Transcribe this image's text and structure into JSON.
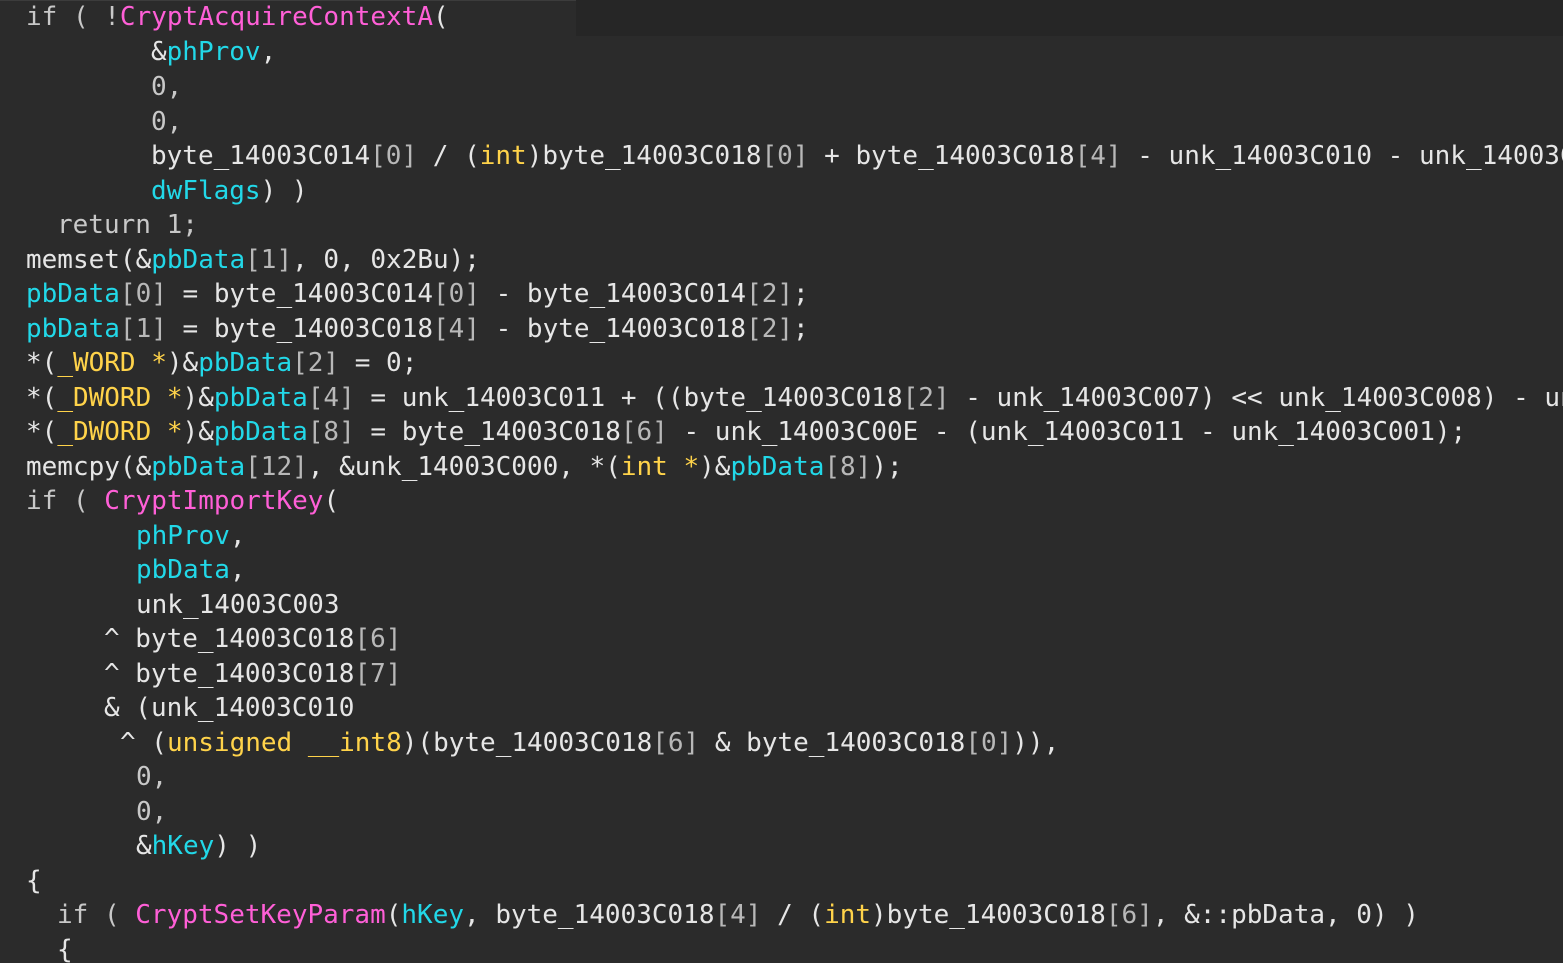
{
  "colors": {
    "background": "#2b2b2b",
    "plain": "#e6e6e6",
    "keyword": "#c8c8c8",
    "api": "#ff5fd7",
    "variable": "#22d8e8",
    "type": "#ffd34a"
  },
  "lines": [
    {
      "tokens": [
        [
          "if ( !",
          "kw"
        ],
        [
          "CryptAcquireContextA",
          "api"
        ],
        [
          "(",
          "plain"
        ]
      ]
    },
    {
      "tokens": [
        [
          "&",
          "plain"
        ],
        [
          "phProv",
          "var"
        ],
        [
          ",",
          "plain"
        ]
      ]
    },
    {
      "tokens": [
        [
          "0,",
          "num"
        ]
      ]
    },
    {
      "tokens": [
        [
          "0,",
          "num"
        ]
      ]
    },
    {
      "tokens": [
        [
          "byte_14003C014",
          "plain"
        ],
        [
          "[0]",
          "idx"
        ],
        [
          " / (",
          "plain"
        ],
        [
          "int",
          "type"
        ],
        [
          ")byte_14003C018",
          "plain"
        ],
        [
          "[0]",
          "idx"
        ],
        [
          " + byte_14003C018",
          "plain"
        ],
        [
          "[4]",
          "idx"
        ],
        [
          " - unk_14003C010 - unk_14003C",
          "plain"
        ]
      ]
    },
    {
      "tokens": [
        [
          "dwFlags",
          "var"
        ],
        [
          ") )",
          "plain"
        ]
      ]
    },
    {
      "tokens": [
        [
          "return 1;",
          "kw"
        ]
      ]
    },
    {
      "tokens": [
        [
          "memset(&",
          "plain"
        ],
        [
          "pbData",
          "var"
        ],
        [
          "[1]",
          "idx"
        ],
        [
          ", 0, 0x2Bu);",
          "plain"
        ]
      ]
    },
    {
      "tokens": [
        [
          "pbData",
          "var"
        ],
        [
          "[0]",
          "idx"
        ],
        [
          " = byte_14003C014",
          "plain"
        ],
        [
          "[0]",
          "idx"
        ],
        [
          " - byte_14003C014",
          "plain"
        ],
        [
          "[2]",
          "idx"
        ],
        [
          ";",
          "plain"
        ]
      ]
    },
    {
      "tokens": [
        [
          "pbData",
          "var"
        ],
        [
          "[1]",
          "idx"
        ],
        [
          " = byte_14003C018",
          "plain"
        ],
        [
          "[4]",
          "idx"
        ],
        [
          " - byte_14003C018",
          "plain"
        ],
        [
          "[2]",
          "idx"
        ],
        [
          ";",
          "plain"
        ]
      ]
    },
    {
      "tokens": [
        [
          "*(",
          "plain"
        ],
        [
          "_WORD *",
          "type"
        ],
        [
          ")&",
          "plain"
        ],
        [
          "pbData",
          "var"
        ],
        [
          "[2]",
          "idx"
        ],
        [
          " = 0;",
          "plain"
        ]
      ]
    },
    {
      "tokens": [
        [
          "*(",
          "plain"
        ],
        [
          "_DWORD *",
          "type"
        ],
        [
          ")&",
          "plain"
        ],
        [
          "pbData",
          "var"
        ],
        [
          "[4]",
          "idx"
        ],
        [
          " = unk_14003C011 + ((byte_14003C018",
          "plain"
        ],
        [
          "[2]",
          "idx"
        ],
        [
          " - unk_14003C007) << unk_14003C008) - un",
          "plain"
        ]
      ]
    },
    {
      "tokens": [
        [
          "*(",
          "plain"
        ],
        [
          "_DWORD *",
          "type"
        ],
        [
          ")&",
          "plain"
        ],
        [
          "pbData",
          "var"
        ],
        [
          "[8]",
          "idx"
        ],
        [
          " = byte_14003C018",
          "plain"
        ],
        [
          "[6]",
          "idx"
        ],
        [
          " - unk_14003C00E - (unk_14003C011 - unk_14003C001);",
          "plain"
        ]
      ]
    },
    {
      "tokens": [
        [
          "memcpy(&",
          "plain"
        ],
        [
          "pbData",
          "var"
        ],
        [
          "[12]",
          "idx"
        ],
        [
          ", &unk_14003C000, *(",
          "plain"
        ],
        [
          "int *",
          "type"
        ],
        [
          ")&",
          "plain"
        ],
        [
          "pbData",
          "var"
        ],
        [
          "[8]",
          "idx"
        ],
        [
          ");",
          "plain"
        ]
      ]
    },
    {
      "tokens": [
        [
          "if ( ",
          "kw"
        ],
        [
          "CryptImportKey",
          "api"
        ],
        [
          "(",
          "plain"
        ]
      ]
    },
    {
      "tokens": [
        [
          "phProv",
          "var"
        ],
        [
          ",",
          "plain"
        ]
      ]
    },
    {
      "tokens": [
        [
          "pbData",
          "var"
        ],
        [
          ",",
          "plain"
        ]
      ]
    },
    {
      "tokens": [
        [
          "unk_14003C003",
          "plain"
        ]
      ]
    },
    {
      "tokens": [
        [
          "^ byte_14003C018",
          "plain"
        ],
        [
          "[6]",
          "idx"
        ]
      ]
    },
    {
      "tokens": [
        [
          "^ byte_14003C018",
          "plain"
        ],
        [
          "[7]",
          "idx"
        ]
      ]
    },
    {
      "tokens": [
        [
          "& (unk_14003C010",
          "plain"
        ]
      ]
    },
    {
      "tokens": [
        [
          "^ (",
          "plain"
        ],
        [
          "unsigned __int8",
          "type"
        ],
        [
          ")(byte_14003C018",
          "plain"
        ],
        [
          "[6]",
          "idx"
        ],
        [
          " & byte_14003C018",
          "plain"
        ],
        [
          "[0]",
          "idx"
        ],
        [
          ")),",
          "plain"
        ]
      ]
    },
    {
      "tokens": [
        [
          "0,",
          "num"
        ]
      ]
    },
    {
      "tokens": [
        [
          "0,",
          "num"
        ]
      ]
    },
    {
      "tokens": [
        [
          "&",
          "plain"
        ],
        [
          "hKey",
          "var"
        ],
        [
          ") )",
          "plain"
        ]
      ]
    },
    {
      "tokens": [
        [
          "{",
          "plain"
        ]
      ]
    },
    {
      "tokens": [
        [
          "if ( ",
          "kw"
        ],
        [
          "CryptSetKeyParam",
          "api"
        ],
        [
          "(",
          "plain"
        ],
        [
          "hKey",
          "var"
        ],
        [
          ", byte_14003C018",
          "plain"
        ],
        [
          "[4]",
          "idx"
        ],
        [
          " / (",
          "plain"
        ],
        [
          "int",
          "type"
        ],
        [
          ")byte_14003C018",
          "plain"
        ],
        [
          "[6]",
          "idx"
        ],
        [
          ", &::pbData, 0) )",
          "plain"
        ]
      ]
    },
    {
      "tokens": [
        [
          "{",
          "plain"
        ]
      ]
    }
  ]
}
